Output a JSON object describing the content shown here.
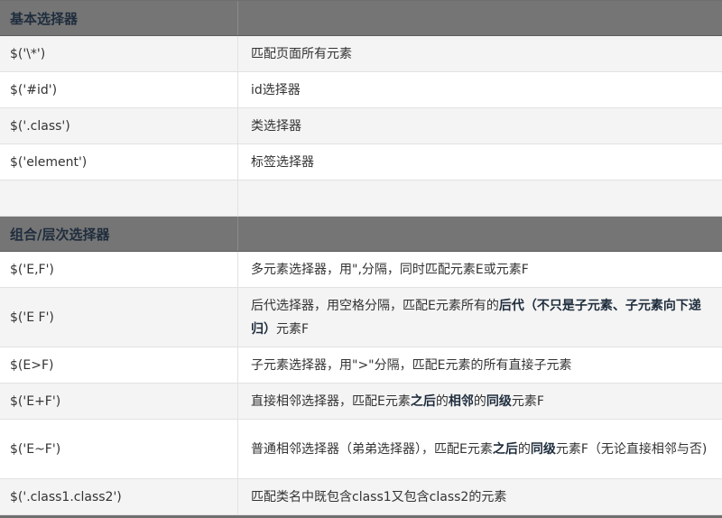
{
  "sections": [
    {
      "header": "基本选择器",
      "rows": [
        {
          "selector": "$('\\*')",
          "desc": "匹配页面所有元素"
        },
        {
          "selector": "$('#id')",
          "desc": "id选择器"
        },
        {
          "selector": "$('.class')",
          "desc": "类选择器"
        },
        {
          "selector": "$('element')",
          "desc": "标签选择器"
        },
        {
          "selector": "",
          "desc": ""
        }
      ]
    },
    {
      "header": "组合/层次选择器",
      "rows": [
        {
          "selector": "$('E,F')",
          "desc_parts": [
            "多元素选择器，用\",分隔，同时匹配元素E或元素F"
          ]
        },
        {
          "selector": "$('E F')",
          "desc_parts": [
            "后代选择器，用空格分隔，匹配E元素所有的",
            "后代（不只是子元素、子元素向下递归）",
            "元素F"
          ]
        },
        {
          "selector": "$(E>F)",
          "desc_parts": [
            "子元素选择器，用\">\"分隔，匹配E元素的所有直接子元素"
          ]
        },
        {
          "selector": "$('E+F')",
          "desc_parts": [
            "直接相邻选择器，匹配E元素",
            "之后",
            "的",
            "相邻",
            "的",
            "同级",
            "元素F"
          ]
        },
        {
          "selector": "$('E~F')",
          "desc_parts": [
            "普通相邻选择器（弟弟选择器），匹配E元素",
            "之后",
            "的",
            "同级",
            "元素F（无论直接相邻与否)"
          ]
        },
        {
          "selector": "$('.class1.class2')",
          "desc_parts": [
            "匹配类名中既包含class1又包含class2的元素"
          ]
        }
      ]
    }
  ]
}
